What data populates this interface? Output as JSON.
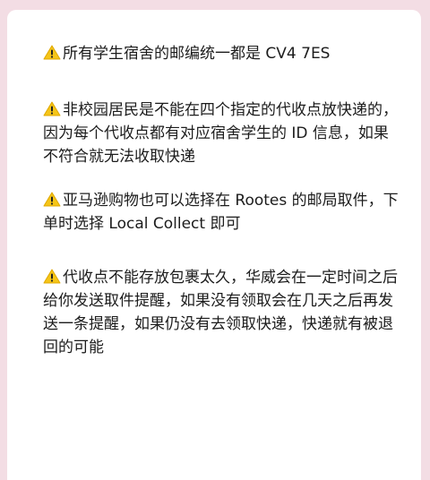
{
  "background_color": "#f3dde4",
  "card_color": "#ffffff",
  "warning_icon": "warning-triangle",
  "warning_color": "#f5c518",
  "notices": [
    {
      "text": "所有学生宿舍的邮编统一都是 CV4 7ES"
    },
    {
      "text": "非校园居民是不能在四个指定的代收点放快递的，因为每个代收点都有对应宿舍学生的 ID 信息，如果不符合就无法收取快递"
    },
    {
      "text": "亚马逊购物也可以选择在 Rootes 的邮局取件，下单时选择 Local Collect 即可"
    },
    {
      "text": "代收点不能存放包裹太久，华威会在一定时间之后给你发送取件提醒，如果没有领取会在几天之后再发送一条提醒，如果仍没有去领取快递，快递就有被退回的可能"
    }
  ]
}
